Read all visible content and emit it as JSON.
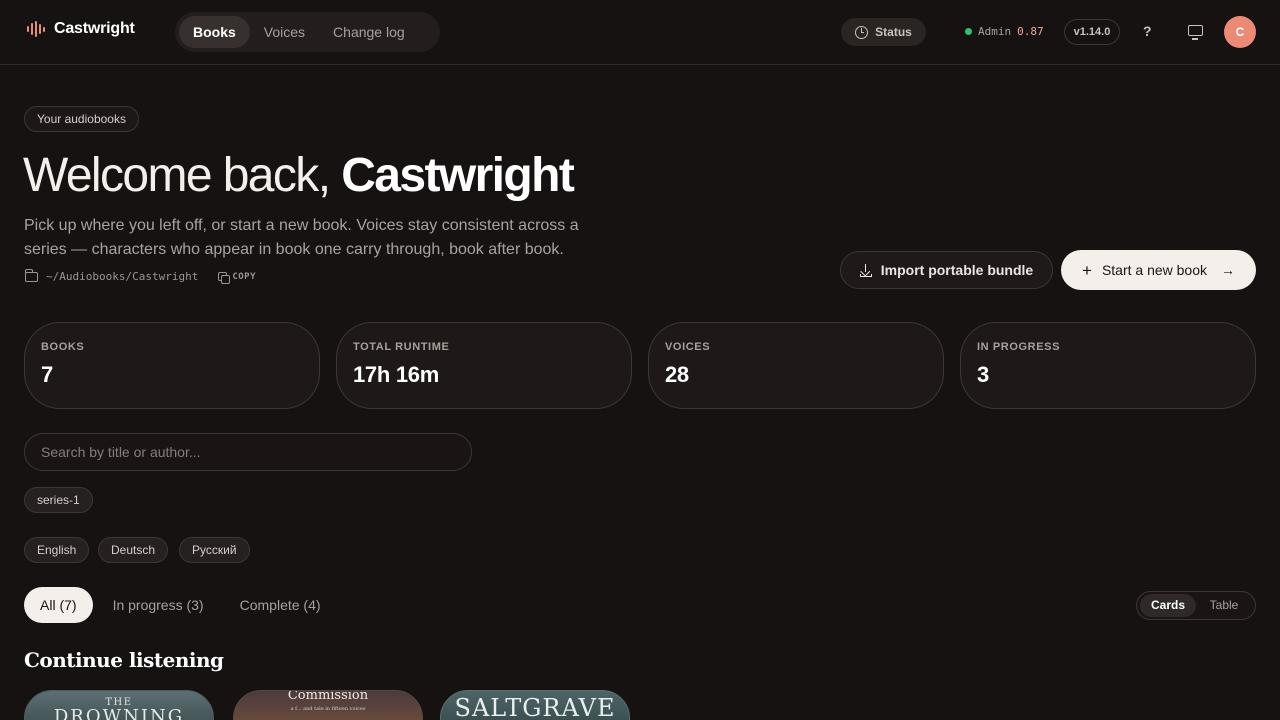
{
  "brand": {
    "name": "Castwright"
  },
  "nav": {
    "items": [
      "Books",
      "Voices",
      "Change log"
    ],
    "active": "Books"
  },
  "topbar": {
    "status_label": "Status",
    "admin_label": "Admin",
    "admin_value": "0.87",
    "version": "v1.14.0",
    "help": "?",
    "avatar_initial": "C"
  },
  "hero": {
    "tag": "Your audiobooks",
    "greeting": "Welcome back,",
    "name": "Castwright",
    "subtitle": "Pick up where you left off, or start a new book. Voices stay consistent across a series — characters who appear in book one carry through, book after book.",
    "path": "~/Audiobooks/Castwright",
    "copy_label": "COPY",
    "import_label": "Import portable bundle",
    "new_book_label": "Start a new book"
  },
  "stats": [
    {
      "label": "BOOKS",
      "value": "7"
    },
    {
      "label": "TOTAL RUNTIME",
      "value": "17h 16m"
    },
    {
      "label": "VOICES",
      "value": "28"
    },
    {
      "label": "IN PROGRESS",
      "value": "3"
    }
  ],
  "search": {
    "placeholder": "Search by title or author..."
  },
  "series_chips": [
    "series-1"
  ],
  "language_chips": [
    "English",
    "Deutsch",
    "Русский"
  ],
  "filter_tabs": [
    "All (7)",
    "In progress (3)",
    "Complete (4)"
  ],
  "view_toggle": {
    "options": [
      "Cards",
      "Table"
    ],
    "active": "Cards"
  },
  "section": {
    "title": "Continue listening"
  },
  "covers": [
    {
      "small": "THE",
      "big": "DROWNING"
    },
    {
      "title": "Commission",
      "sub": "a f... and tale in fifteen voices"
    },
    {
      "title": "SALTGRAVE"
    }
  ],
  "colors": {
    "accent": "#ea8a77",
    "background": "#161212",
    "status_online": "#2fc46b"
  }
}
